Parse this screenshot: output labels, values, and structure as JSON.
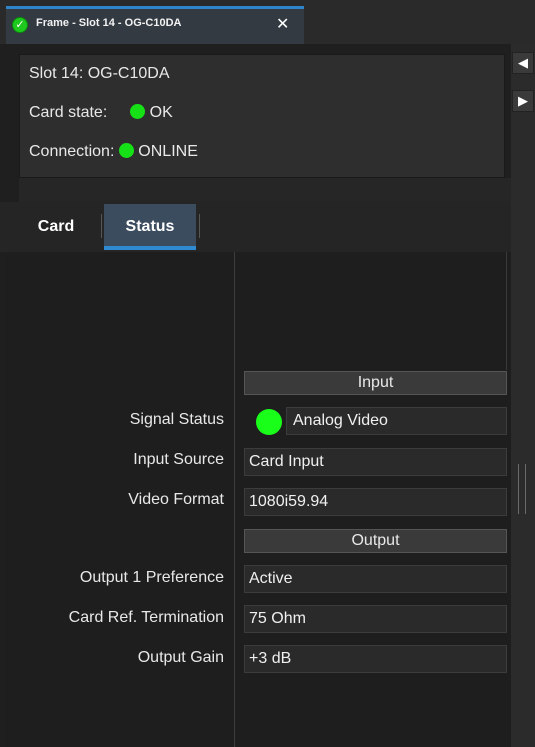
{
  "doc_tab": {
    "title": "Frame - Slot 14 - OG-C10DA",
    "close_glyph": "✕",
    "status_glyph": "✓"
  },
  "info": {
    "slot": "Slot 14: OG-C10DA",
    "card_state_label": "Card state:",
    "card_state_value": "OK",
    "connection_label": "Connection:",
    "connection_value": "ONLINE"
  },
  "nav_arrows": {
    "left": "◀",
    "right": "▶"
  },
  "tabs": {
    "card": "Card",
    "status": "Status"
  },
  "sections": {
    "input": "Input",
    "output": "Output"
  },
  "rows": {
    "signal_status": {
      "label": "Signal Status",
      "value": "Analog Video"
    },
    "input_source": {
      "label": "Input Source",
      "value": "Card Input"
    },
    "video_format": {
      "label": "Video Format",
      "value": "1080i59.94"
    },
    "output1_pref": {
      "label": "Output 1 Preference",
      "value": "Active"
    },
    "card_ref_term": {
      "label": "Card Ref. Termination",
      "value": "75 Ohm"
    },
    "output_gain": {
      "label": "Output Gain",
      "value": "+3 dB"
    }
  },
  "colors": {
    "status_green": "#16e016",
    "accent_blue": "#2f8ad2"
  }
}
